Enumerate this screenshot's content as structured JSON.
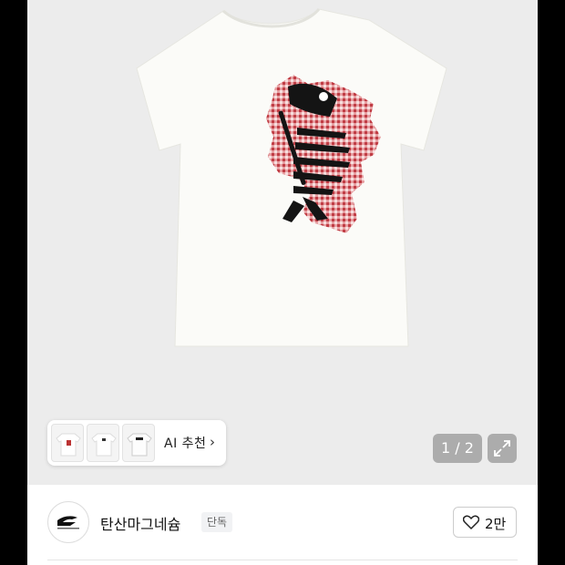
{
  "gallery": {
    "product_image": "white-tshirt-fishbone-print",
    "thumbnails": [
      "thumbnail-1",
      "thumbnail-2",
      "thumbnail-3"
    ],
    "ai_recommend_label": "AI 추천",
    "page_counter": "1 / 2"
  },
  "seller": {
    "name": "탄산마그네슘",
    "badge": "단독",
    "like_count": "2만"
  },
  "icons": {
    "chevron": "chevron-right-icon",
    "expand": "expand-icon",
    "heart": "heart-icon"
  },
  "colors": {
    "gingham_red": "#c8454b",
    "overlay_gray": "#8a8a8a"
  }
}
